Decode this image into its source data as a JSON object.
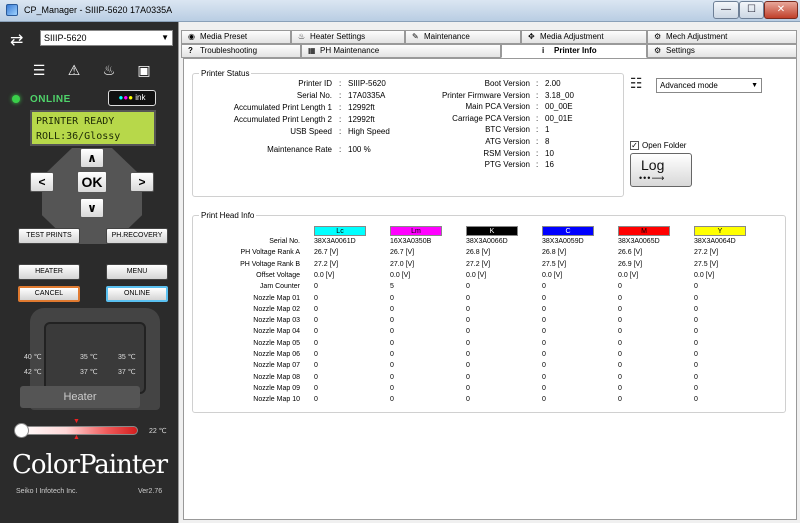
{
  "window": {
    "title": "CP_Manager - SIIIP-5620 17A0335A",
    "min": "—",
    "max": "☐",
    "close": "✕"
  },
  "left": {
    "printer_select": "SIIIP-5620",
    "status": "ONLINE",
    "ink_badge": "ink",
    "lcd_line1": "PRINTER READY",
    "lcd_line2": "ROLL:36/Glossy",
    "dpad": {
      "up": "∧",
      "down": "∨",
      "left": "<",
      "right": ">",
      "ok": "OK"
    },
    "buttons": {
      "test_prints": "TEST PRINTS",
      "ph_recovery": "PH.RECOVERY",
      "heater": "HEATER",
      "menu": "MENU",
      "cancel": "CANCEL",
      "online": "ONLINE"
    },
    "heater": {
      "label": "Heater",
      "t_left_top": "40 ℃",
      "t_mid_top": "35 ℃",
      "t_right_top": "35 ℃",
      "t_left_bot": "42 ℃",
      "t_mid_bot": "37 ℃",
      "t_right_bot": "37 ℃",
      "bar_temp": "22 ℃"
    },
    "logo": "ColorPainter",
    "company": "Seiko I Infotech Inc.",
    "version": "Ver2.76"
  },
  "tabs_top": [
    "Media Preset",
    "Heater Settings",
    "Maintenance",
    "Media Adjustment",
    "Mech Adjustment"
  ],
  "tabs_bottom": [
    "Troubleshooting",
    "PH Maintenance",
    "Printer Info",
    "Settings"
  ],
  "printer_status": {
    "title": "Printer Status",
    "left": [
      {
        "label": "Printer ID",
        "value": "SIIIP-5620"
      },
      {
        "label": "Serial No.",
        "value": "17A0335A"
      },
      {
        "label": "Accumulated Print Length 1",
        "value": "12992ft"
      },
      {
        "label": "Accumulated Print Length 2",
        "value": "12992ft"
      },
      {
        "label": "USB Speed",
        "value": "High Speed"
      },
      {
        "label": "Maintenance Rate",
        "value": "100 %"
      }
    ],
    "right": [
      {
        "label": "Boot Version",
        "value": "2.00"
      },
      {
        "label": "Printer Firmware Version",
        "value": "3.18_00"
      },
      {
        "label": "Main PCA Version",
        "value": "00_00E"
      },
      {
        "label": "Carriage PCA Version",
        "value": "00_01E"
      },
      {
        "label": "BTC Version",
        "value": "1"
      },
      {
        "label": "ATG Version",
        "value": "8"
      },
      {
        "label": "RSM Version",
        "value": "10"
      },
      {
        "label": "PTG Version",
        "value": "16"
      }
    ],
    "colon": ":"
  },
  "mode_select": "Advanced mode",
  "open_folder": "Open Folder",
  "log_button": "Log",
  "print_head": {
    "title": "Print Head Info",
    "columns": [
      {
        "name": "Lc",
        "color": "#00ffff",
        "text": "#000000"
      },
      {
        "name": "Lm",
        "color": "#ff00ff",
        "text": "#000000"
      },
      {
        "name": "K",
        "color": "#000000",
        "text": "#ffffff"
      },
      {
        "name": "C",
        "color": "#0000ff",
        "text": "#ffffff"
      },
      {
        "name": "M",
        "color": "#ff0000",
        "text": "#000000"
      },
      {
        "name": "Y",
        "color": "#ffff00",
        "text": "#000000"
      }
    ],
    "rows": [
      {
        "label": "Serial No.",
        "values": [
          "38X3A0061D",
          "16X3A0350B",
          "38X3A0066D",
          "38X3A0059D",
          "38X3A0065D",
          "38X3A0064D"
        ]
      },
      {
        "label": "PH Voltage Rank A",
        "values": [
          "26.7 [V]",
          "26.7 [V]",
          "26.8 [V]",
          "26.8 [V]",
          "26.6 [V]",
          "27.2 [V]"
        ]
      },
      {
        "label": "PH Voltage Rank B",
        "values": [
          "27.2 [V]",
          "27.0 [V]",
          "27.2 [V]",
          "27.5 [V]",
          "26.9 [V]",
          "27.5 [V]"
        ]
      },
      {
        "label": "Offset Voltage",
        "values": [
          "0.0 [V]",
          "0.0 [V]",
          "0.0 [V]",
          "0.0 [V]",
          "0.0 [V]",
          "0.0 [V]"
        ]
      },
      {
        "label": "Jam Counter",
        "values": [
          "0",
          "5",
          "0",
          "0",
          "0",
          "0"
        ]
      },
      {
        "label": "Nozzle Map 01",
        "values": [
          "0",
          "0",
          "0",
          "0",
          "0",
          "0"
        ]
      },
      {
        "label": "Nozzle Map 02",
        "values": [
          "0",
          "0",
          "0",
          "0",
          "0",
          "0"
        ]
      },
      {
        "label": "Nozzle Map 03",
        "values": [
          "0",
          "0",
          "0",
          "0",
          "0",
          "0"
        ]
      },
      {
        "label": "Nozzle Map 04",
        "values": [
          "0",
          "0",
          "0",
          "0",
          "0",
          "0"
        ]
      },
      {
        "label": "Nozzle Map 05",
        "values": [
          "0",
          "0",
          "0",
          "0",
          "0",
          "0"
        ]
      },
      {
        "label": "Nozzle Map 06",
        "values": [
          "0",
          "0",
          "0",
          "0",
          "0",
          "0"
        ]
      },
      {
        "label": "Nozzle Map 07",
        "values": [
          "0",
          "0",
          "0",
          "0",
          "0",
          "0"
        ]
      },
      {
        "label": "Nozzle Map 08",
        "values": [
          "0",
          "0",
          "0",
          "0",
          "0",
          "0"
        ]
      },
      {
        "label": "Nozzle Map 09",
        "values": [
          "0",
          "0",
          "0",
          "0",
          "0",
          "0"
        ]
      },
      {
        "label": "Nozzle Map 10",
        "values": [
          "0",
          "0",
          "0",
          "0",
          "0",
          "0"
        ]
      }
    ]
  }
}
